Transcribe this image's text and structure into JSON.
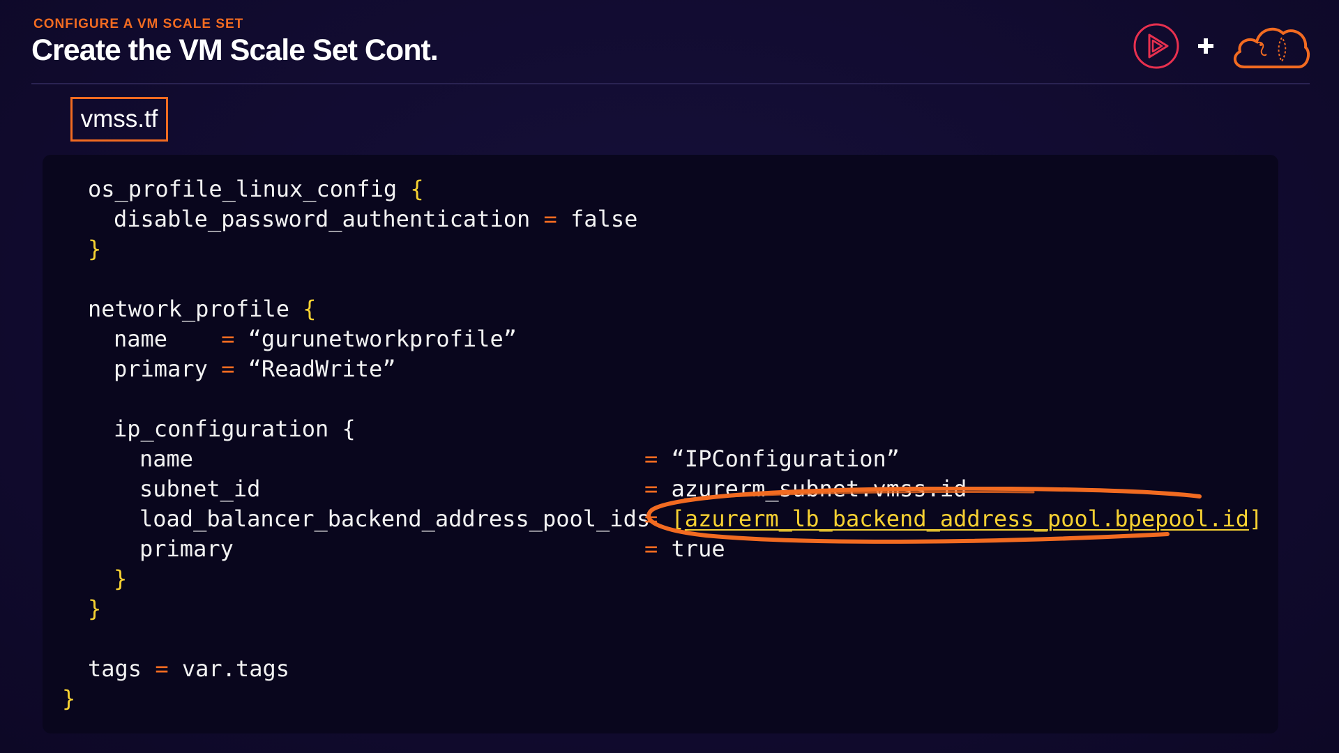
{
  "header": {
    "eyebrow": "CONFIGURE A VM SCALE SET",
    "title": "Create the VM Scale Set Cont."
  },
  "logos": {
    "left": "pluralsight-play-logo-icon",
    "joiner": "+",
    "right": "acloudguru-cloud-logo-icon"
  },
  "file_tab": {
    "label": "vmss.tf"
  },
  "code": {
    "line1_key": "os_profile_linux_config ",
    "line1_brace": "{",
    "line2_key": "disable_password_authentication ",
    "line2_op": "=",
    "line2_val": " false",
    "line3_brace": "}",
    "line5_key": "network_profile ",
    "line5_brace": "{",
    "line6_key": "name    ",
    "line6_op": "=",
    "line6_val": " “gurunetworkprofile”",
    "line7_key": "primary ",
    "line7_op": "=",
    "line7_val": " “ReadWrite”",
    "line9_key": "ip_configuration {",
    "line10_key": "name",
    "line10_op": "=",
    "line10_val": " “IPConfiguration”",
    "line11_key": "subnet_id",
    "line11_op": "=",
    "line11_val": " azurerm_subnet.vmss.id",
    "line12_key": "load_balancer_backend_address_pool_ids",
    "line12_op": "=",
    "line12_val_open": " [",
    "line12_ref": "azurerm_lb_backend_address_pool.bpepool.id",
    "line12_val_close": "]",
    "line13_key": "primary",
    "line13_op": "=",
    "line13_val": " true",
    "line14_brace": "}",
    "line15_brace": "}",
    "line17_key": "tags ",
    "line17_op": "=",
    "line17_val": " var.tags",
    "line18_brace": "}"
  },
  "colors": {
    "accent": "#f26b21",
    "brace": "#f6d132",
    "text": "#f2f2f2",
    "background": "#120c32",
    "code_background": "#09061d"
  },
  "annotation": {
    "shape": "hand-drawn-ellipse",
    "color": "#f26b21"
  }
}
